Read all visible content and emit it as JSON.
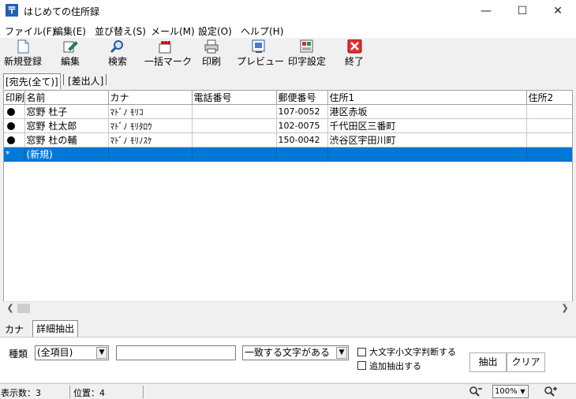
{
  "window": {
    "title": "はじめての住所録",
    "app_icon_glyph": "〒",
    "minimize": "—",
    "maximize": "☐",
    "close": "✕"
  },
  "menu": [
    "ファイル(F)",
    "編集(E)",
    "並び替え(S)",
    "メール(M)",
    "設定(O)",
    "ヘルプ(H)"
  ],
  "toolbar": {
    "new": "新規登録",
    "edit": "編集",
    "search": "検索",
    "bulk_mark": "一括マーク",
    "print": "印刷",
    "preview": "プレビュー",
    "print_settings": "印字設定",
    "exit": "終了"
  },
  "top_tabs": [
    "[宛先(全て)]",
    "[差出人]"
  ],
  "grid": {
    "columns": [
      "印刷",
      "名前",
      "カナ",
      "電話番号",
      "郵便番号",
      "住所1",
      "住所2"
    ],
    "rows": [
      {
        "mark": "●",
        "name": "窓野 杜子",
        "kana": "ﾏﾄﾞﾉ ﾓﾘｺ",
        "phone": "",
        "zip": "107-0052",
        "addr1": "港区赤坂",
        "addr2": ""
      },
      {
        "mark": "●",
        "name": "窓野 杜太郎",
        "kana": "ﾏﾄﾞﾉ ﾓﾘﾀﾛｳ",
        "phone": "",
        "zip": "102-0075",
        "addr1": "千代田区三番町",
        "addr2": ""
      },
      {
        "mark": "●",
        "name": "窓野 杜の輔",
        "kana": "ﾏﾄﾞﾉ ﾓﾘﾉｽｹ",
        "phone": "",
        "zip": "150-0042",
        "addr1": "渋谷区宇田川町",
        "addr2": ""
      }
    ],
    "new_row": {
      "marker": "*",
      "label": "(新規)"
    }
  },
  "bottom_tabs": [
    "カナ",
    "詳細抽出"
  ],
  "filter": {
    "kind_label": "種類",
    "kind_value": "(全項目)",
    "text_value": "",
    "match_value": "一致する文字がある",
    "case_option": "大文字小文字判断する",
    "append_option": "追加抽出する",
    "extract_button": "抽出",
    "clear_button": "クリア"
  },
  "status": {
    "count": "表示数：3",
    "position": "位置：4",
    "zoom": "100%"
  },
  "colors": {
    "selection": "#0078d7",
    "app_icon": "#1f5fb8"
  }
}
